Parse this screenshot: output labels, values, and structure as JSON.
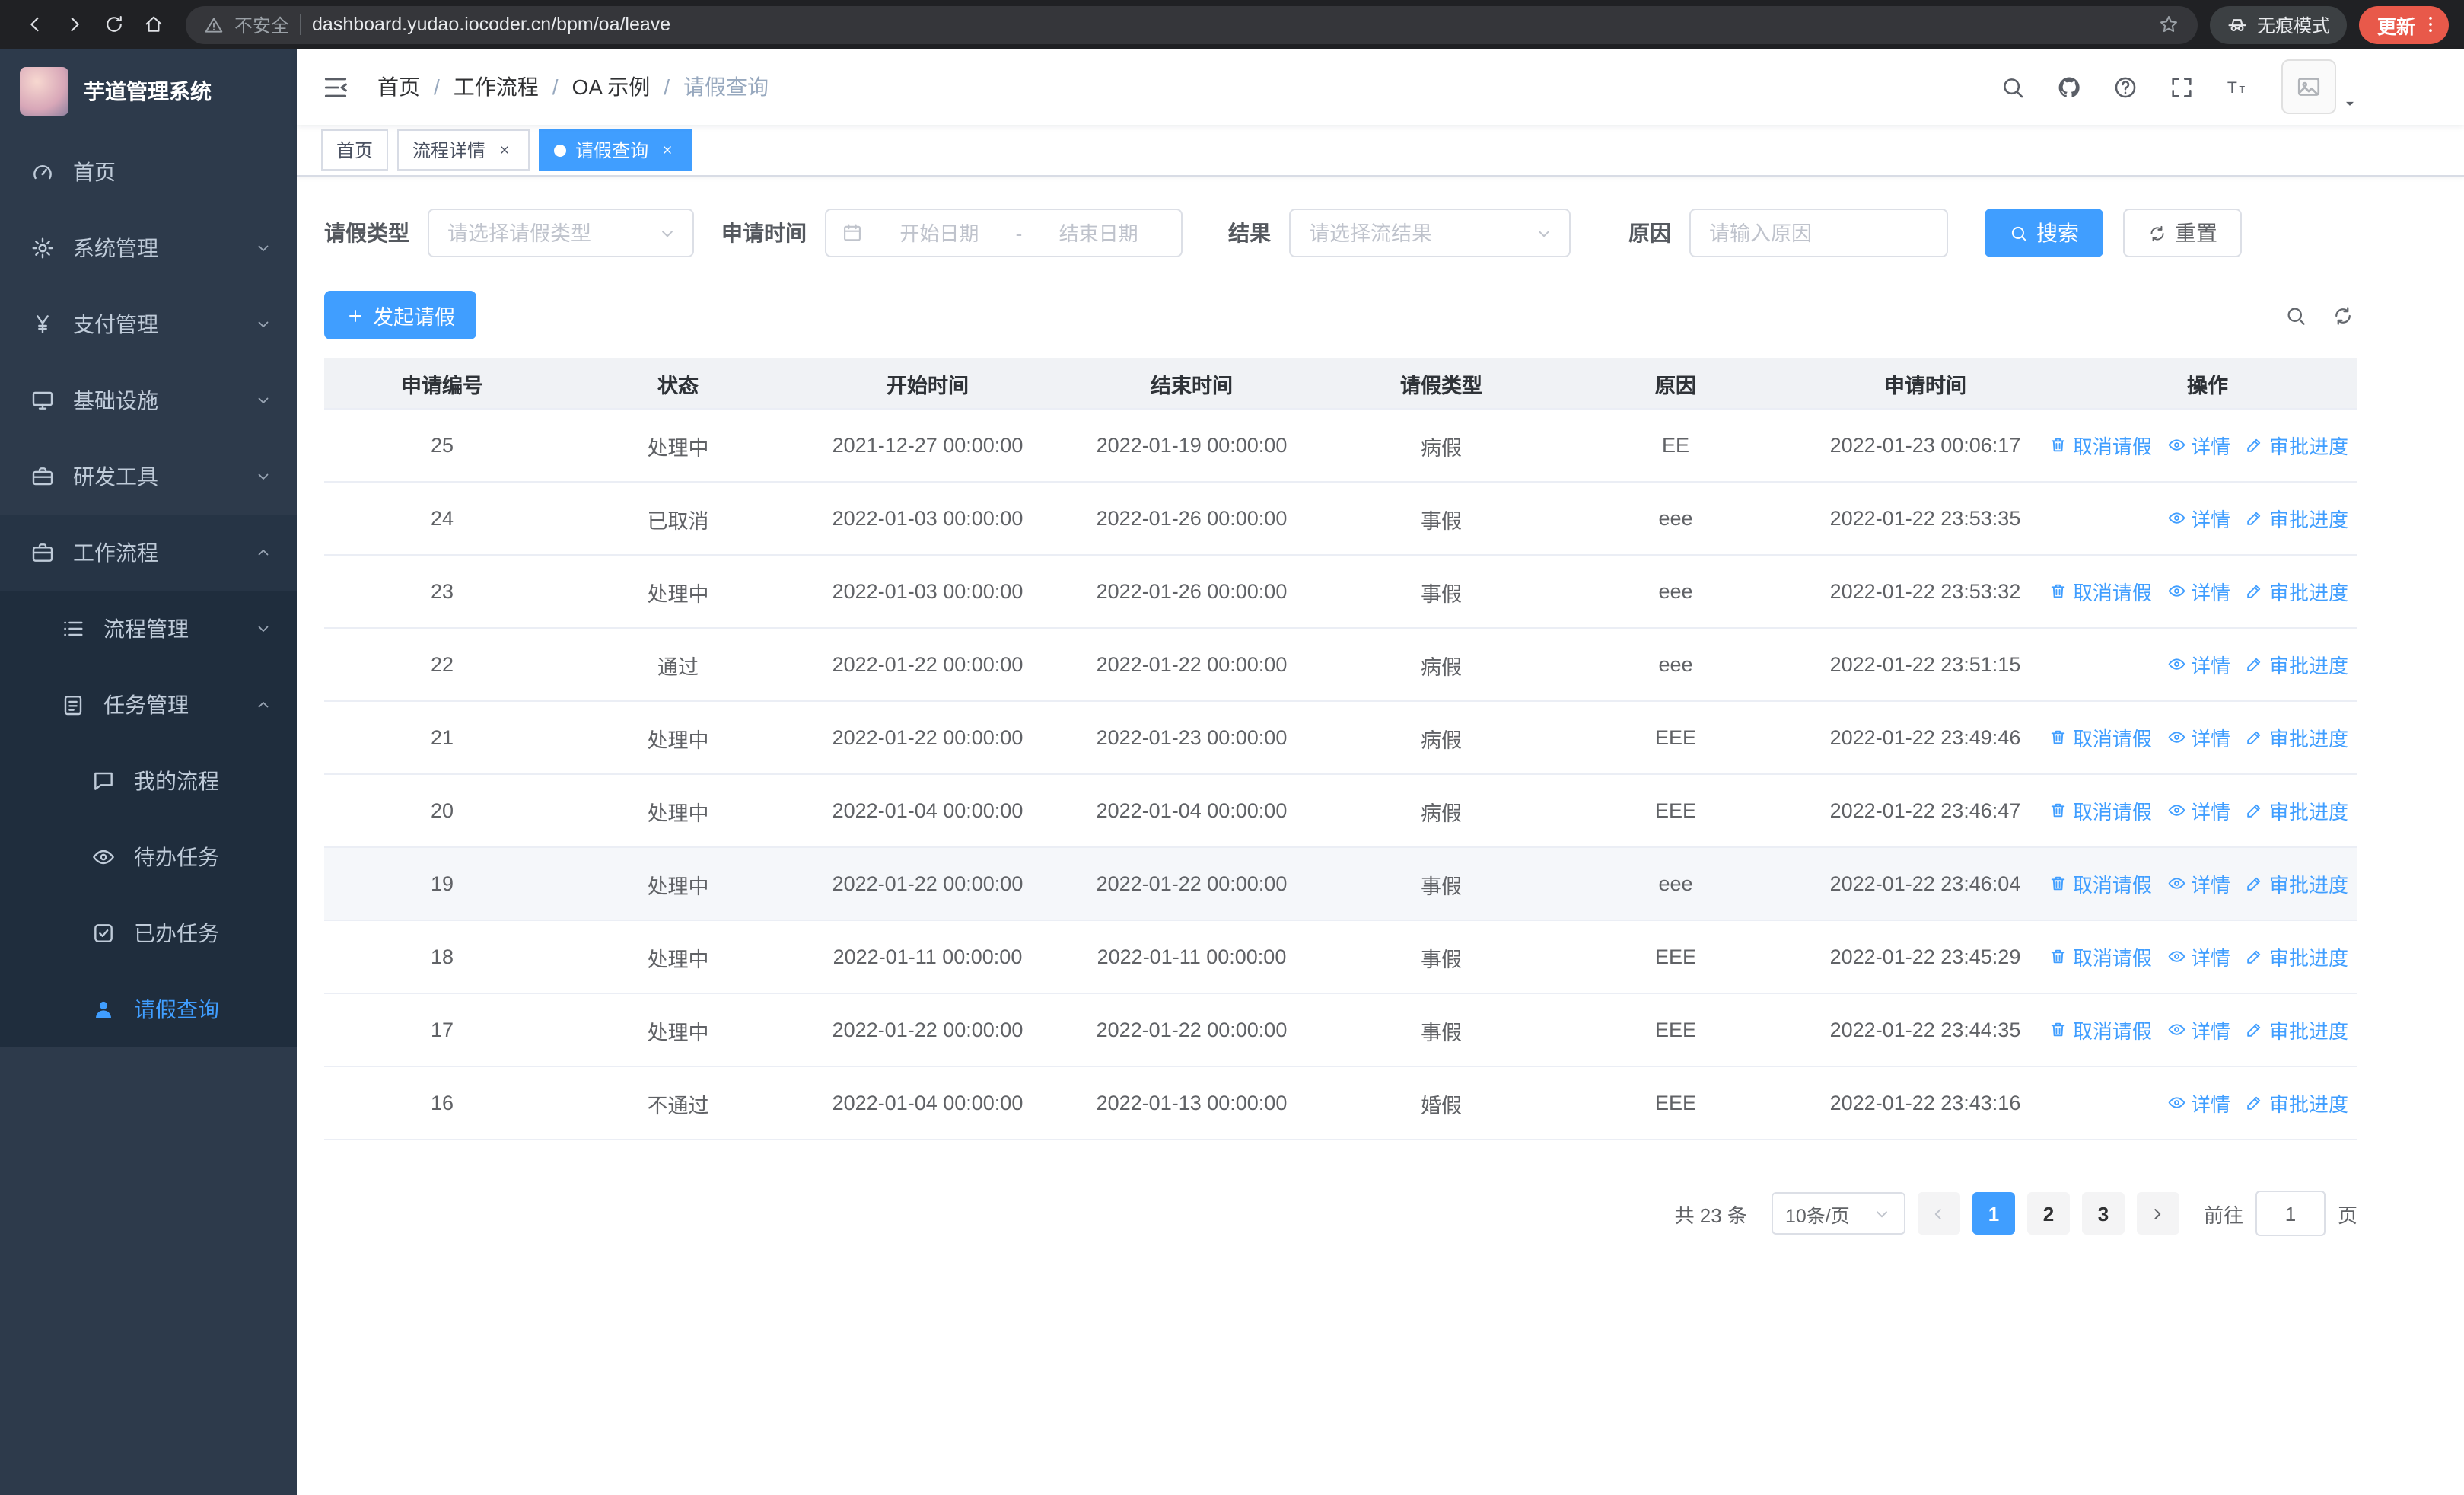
{
  "browser": {
    "security_label": "不安全",
    "url": "dashboard.yudao.iocoder.cn/bpm/oa/leave",
    "incognito_label": "无痕模式",
    "update_label": "更新"
  },
  "sidebar": {
    "app_title": "芋道管理系统",
    "items": [
      {
        "label": "首页",
        "icon": "dashboard-icon",
        "level": 1
      },
      {
        "label": "系统管理",
        "icon": "gear-icon",
        "level": 1,
        "chevron": "down"
      },
      {
        "label": "支付管理",
        "icon": "yen-icon",
        "level": 1,
        "chevron": "down"
      },
      {
        "label": "基础设施",
        "icon": "monitor-icon",
        "level": 1,
        "chevron": "down"
      },
      {
        "label": "研发工具",
        "icon": "toolbox-icon",
        "level": 1,
        "chevron": "down"
      },
      {
        "label": "工作流程",
        "icon": "briefcase-icon",
        "level": 1,
        "chevron": "up",
        "open": true
      },
      {
        "label": "流程管理",
        "icon": "list-icon",
        "level": 2,
        "chevron": "down"
      },
      {
        "label": "任务管理",
        "icon": "clipboard-icon",
        "level": 2,
        "chevron": "up"
      },
      {
        "label": "我的流程",
        "icon": "chat-icon",
        "level": 3
      },
      {
        "label": "待办任务",
        "icon": "eye-icon",
        "level": 3
      },
      {
        "label": "已办任务",
        "icon": "check-icon",
        "level": 3
      },
      {
        "label": "请假查询",
        "icon": "user-icon",
        "level": 3,
        "active": true
      }
    ]
  },
  "breadcrumb": {
    "separator": "/",
    "items": [
      "首页",
      "工作流程",
      "OA 示例",
      "请假查询"
    ]
  },
  "tabs": [
    {
      "label": "首页",
      "closable": false,
      "active": false
    },
    {
      "label": "流程详情",
      "closable": true,
      "active": false
    },
    {
      "label": "请假查询",
      "closable": true,
      "active": true
    }
  ],
  "filters": {
    "leave_type_label": "请假类型",
    "leave_type_placeholder": "请选择请假类型",
    "apply_time_label": "申请时间",
    "start_date_placeholder": "开始日期",
    "date_separator": "-",
    "end_date_placeholder": "结束日期",
    "result_label": "结果",
    "result_placeholder": "请选择流结果",
    "reason_label": "原因",
    "reason_placeholder": "请输入原因",
    "search_label": "搜索",
    "reset_label": "重置"
  },
  "toolbar": {
    "create_label": "发起请假"
  },
  "table": {
    "columns": [
      "申请编号",
      "状态",
      "开始时间",
      "结束时间",
      "请假类型",
      "原因",
      "申请时间",
      "操作"
    ],
    "action_labels": {
      "cancel": "取消请假",
      "detail": "详情",
      "progress": "审批进度"
    },
    "rows": [
      {
        "id": "25",
        "status": "处理中",
        "start": "2021-12-27 00:00:00",
        "end": "2022-01-19 00:00:00",
        "type": "病假",
        "reason": "EE",
        "apply_time": "2022-01-23 00:06:17",
        "actions": [
          "cancel",
          "detail",
          "progress"
        ]
      },
      {
        "id": "24",
        "status": "已取消",
        "start": "2022-01-03 00:00:00",
        "end": "2022-01-26 00:00:00",
        "type": "事假",
        "reason": "eee",
        "apply_time": "2022-01-22 23:53:35",
        "actions": [
          "detail",
          "progress"
        ]
      },
      {
        "id": "23",
        "status": "处理中",
        "start": "2022-01-03 00:00:00",
        "end": "2022-01-26 00:00:00",
        "type": "事假",
        "reason": "eee",
        "apply_time": "2022-01-22 23:53:32",
        "actions": [
          "cancel",
          "detail",
          "progress"
        ]
      },
      {
        "id": "22",
        "status": "通过",
        "start": "2022-01-22 00:00:00",
        "end": "2022-01-22 00:00:00",
        "type": "病假",
        "reason": "eee",
        "apply_time": "2022-01-22 23:51:15",
        "actions": [
          "detail",
          "progress"
        ]
      },
      {
        "id": "21",
        "status": "处理中",
        "start": "2022-01-22 00:00:00",
        "end": "2022-01-23 00:00:00",
        "type": "病假",
        "reason": "EEE",
        "apply_time": "2022-01-22 23:49:46",
        "actions": [
          "cancel",
          "detail",
          "progress"
        ]
      },
      {
        "id": "20",
        "status": "处理中",
        "start": "2022-01-04 00:00:00",
        "end": "2022-01-04 00:00:00",
        "type": "病假",
        "reason": "EEE",
        "apply_time": "2022-01-22 23:46:47",
        "actions": [
          "cancel",
          "detail",
          "progress"
        ]
      },
      {
        "id": "19",
        "status": "处理中",
        "start": "2022-01-22 00:00:00",
        "end": "2022-01-22 00:00:00",
        "type": "事假",
        "reason": "eee",
        "apply_time": "2022-01-22 23:46:04",
        "actions": [
          "cancel",
          "detail",
          "progress"
        ],
        "highlight": true
      },
      {
        "id": "18",
        "status": "处理中",
        "start": "2022-01-11 00:00:00",
        "end": "2022-01-11 00:00:00",
        "type": "事假",
        "reason": "EEE",
        "apply_time": "2022-01-22 23:45:29",
        "actions": [
          "cancel",
          "detail",
          "progress"
        ]
      },
      {
        "id": "17",
        "status": "处理中",
        "start": "2022-01-22 00:00:00",
        "end": "2022-01-22 00:00:00",
        "type": "事假",
        "reason": "EEE",
        "apply_time": "2022-01-22 23:44:35",
        "actions": [
          "cancel",
          "detail",
          "progress"
        ]
      },
      {
        "id": "16",
        "status": "不通过",
        "start": "2022-01-04 00:00:00",
        "end": "2022-01-13 00:00:00",
        "type": "婚假",
        "reason": "EEE",
        "apply_time": "2022-01-22 23:43:16",
        "actions": [
          "detail",
          "progress"
        ]
      }
    ]
  },
  "pagination": {
    "total_label": "共 23 条",
    "page_size": "10条/页",
    "pages": [
      "1",
      "2",
      "3"
    ],
    "active_page": "1",
    "goto_label": "前往",
    "goto_value": "1",
    "page_unit": "页"
  },
  "colors": {
    "accent": "#409eff",
    "sidebar_bg": "#2d3a4b",
    "submenu_bg": "#1f2d3d"
  }
}
